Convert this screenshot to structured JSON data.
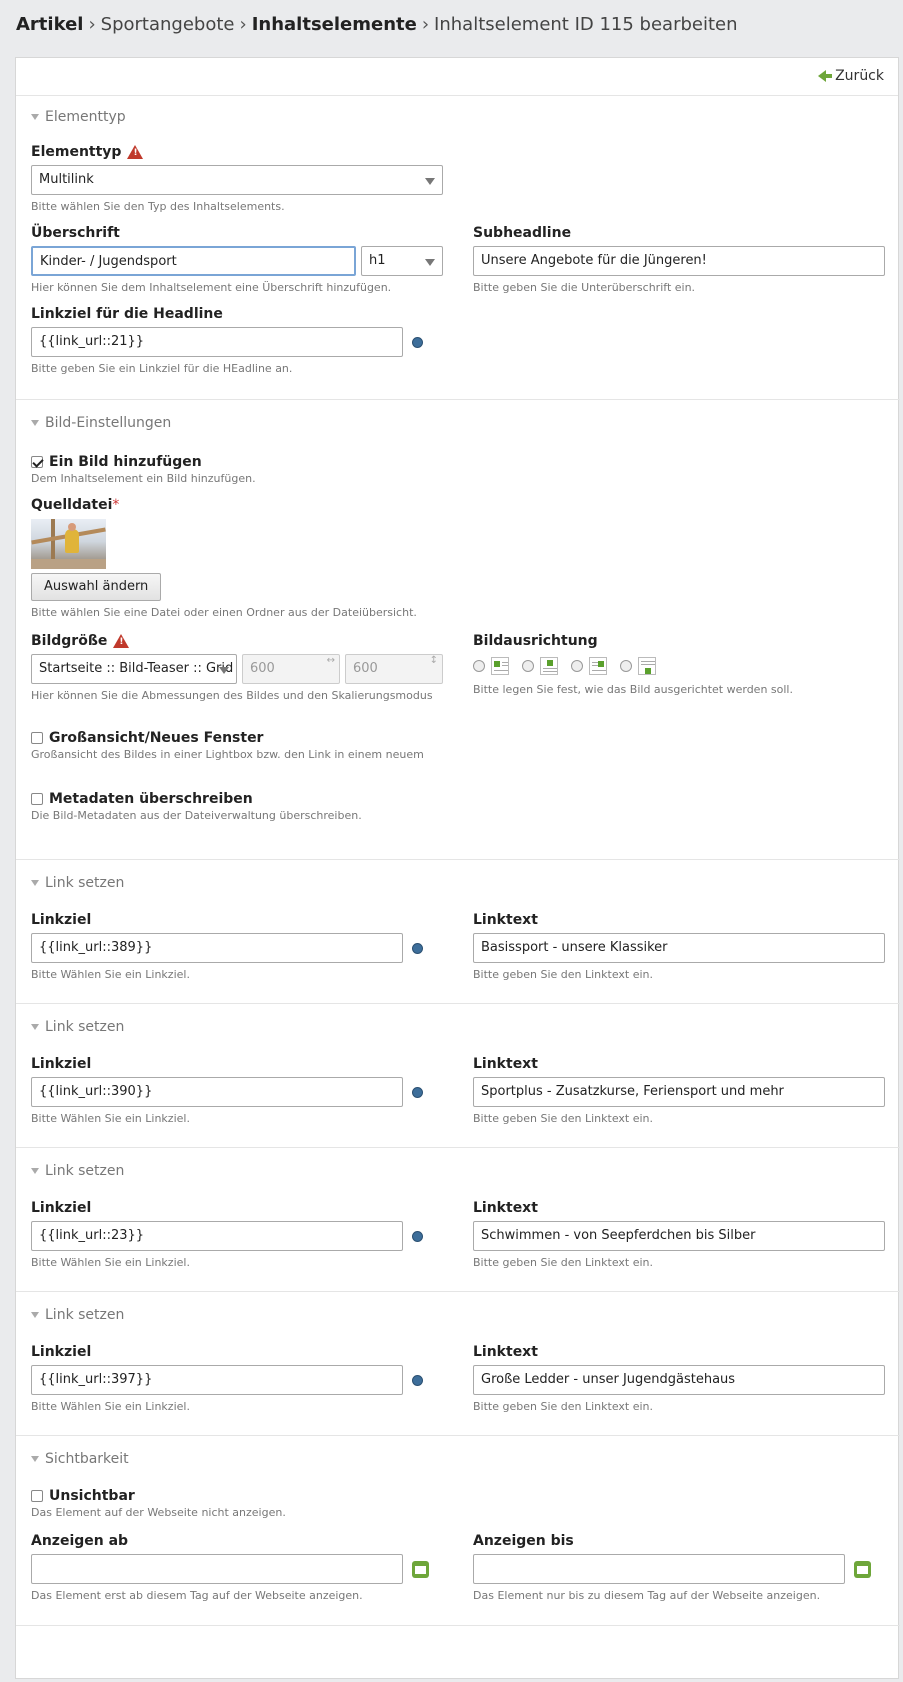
{
  "breadcrumb": {
    "items": [
      "Artikel",
      "Sportangebote",
      "Inhaltselemente",
      "Inhaltselement ID 115 bearbeiten"
    ],
    "separator": "›"
  },
  "toolbar": {
    "back_label": "Zurück"
  },
  "sections": {
    "elementtyp": {
      "legend": "Elementtyp",
      "type_label": "Elementtyp",
      "type_value": "Multilink",
      "type_tip": "Bitte wählen Sie den Typ des Inhaltselements.",
      "headline_label": "Überschrift",
      "headline_value": "Kinder- / Jugendsport",
      "headline_unit": "h1",
      "headline_tip": "Hier können Sie dem Inhaltselement eine Überschrift hinzufügen.",
      "subheadline_label": "Subheadline",
      "subheadline_value": "Unsere Angebote für die Jüngeren!",
      "subheadline_tip": "Bitte geben Sie die Unterüberschrift ein.",
      "headline_link_label": "Linkziel für die Headline",
      "headline_link_value": "{{link_url::21}}",
      "headline_link_tip": "Bitte geben Sie ein Linkziel für die HEadline an."
    },
    "image": {
      "legend": "Bild-Einstellungen",
      "add_image_label": "Ein Bild hinzufügen",
      "add_image_tip": "Dem Inhaltselement ein Bild hinzufügen.",
      "source_label": "Quelldatei",
      "required_mark": "*",
      "change_button": "Auswahl ändern",
      "source_tip": "Bitte wählen Sie eine Datei oder einen Ordner aus der Dateiübersicht.",
      "size_label": "Bildgröße",
      "size_value": "Startseite :: Bild-Teaser :: Grid",
      "width_value": "600",
      "height_value": "600",
      "width_mark": "↔",
      "height_mark": "↕",
      "size_tip": "Hier können Sie die Abmessungen des Bildes und den Skalierungsmodus",
      "align_label": "Bildausrichtung",
      "align_tip": "Bitte legen Sie fest, wie das Bild ausgerichtet werden soll.",
      "lightbox_label": "Großansicht/Neues Fenster",
      "lightbox_tip": "Großansicht des Bildes in einer Lightbox bzw. den Link in einem neuem",
      "meta_label": "Metadaten überschreiben",
      "meta_tip": "Die Bild-Metadaten aus der Dateiverwaltung überschreiben."
    },
    "links": [
      {
        "legend": "Link setzen",
        "target_label": "Linkziel",
        "target_value": "{{link_url::389}}",
        "target_tip": "Bitte Wählen Sie ein Linkziel.",
        "text_label": "Linktext",
        "text_value": "Basissport - unsere Klassiker",
        "text_tip": "Bitte geben Sie den Linktext ein."
      },
      {
        "legend": "Link setzen",
        "target_label": "Linkziel",
        "target_value": "{{link_url::390}}",
        "target_tip": "Bitte Wählen Sie ein Linkziel.",
        "text_label": "Linktext",
        "text_value": "Sportplus - Zusatzkurse, Feriensport und mehr",
        "text_tip": "Bitte geben Sie den Linktext ein."
      },
      {
        "legend": "Link setzen",
        "target_label": "Linkziel",
        "target_value": "{{link_url::23}}",
        "target_tip": "Bitte Wählen Sie ein Linkziel.",
        "text_label": "Linktext",
        "text_value": "Schwimmen - von Seepferdchen bis Silber",
        "text_tip": "Bitte geben Sie den Linktext ein."
      },
      {
        "legend": "Link setzen",
        "target_label": "Linkziel",
        "target_value": "{{link_url::397}}",
        "target_tip": "Bitte Wählen Sie ein Linkziel.",
        "text_label": "Linktext",
        "text_value": "Große Ledder - unser Jugendgästehaus",
        "text_tip": "Bitte geben Sie den Linktext ein."
      }
    ],
    "visibility": {
      "legend": "Sichtbarkeit",
      "invisible_label": "Unsichtbar",
      "invisible_tip": "Das Element auf der Webseite nicht anzeigen.",
      "start_label": "Anzeigen ab",
      "start_value": "",
      "start_tip": "Das Element erst ab diesem Tag auf der Webseite anzeigen.",
      "stop_label": "Anzeigen bis",
      "stop_value": "",
      "stop_tip": "Das Element nur bis zu diesem Tag auf der Webseite anzeigen."
    }
  },
  "colors": {
    "accent_green": "#6ea63a",
    "picker_blue": "#3d6e9a",
    "warn_red": "#c0392b",
    "focus_blue": "#7aa5d6"
  }
}
